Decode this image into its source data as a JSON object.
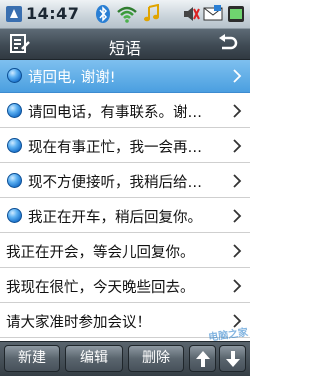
{
  "status_bar": {
    "time": "14:47",
    "icons": [
      "phone-signal-icon",
      "bluetooth-icon",
      "wifi-icon",
      "music-note-icon",
      "sound-icon",
      "mail-icon",
      "battery-icon"
    ]
  },
  "header": {
    "title": "短语",
    "left_icon": "compose-icon",
    "right_icon": "back-arrow-icon"
  },
  "list": {
    "items": [
      {
        "label": "请回电, 谢谢!",
        "has_bullet": true,
        "selected": true
      },
      {
        "label": "请回电话，有事联系。谢…",
        "has_bullet": true,
        "selected": false
      },
      {
        "label": "现在有事正忙，我一会再…",
        "has_bullet": true,
        "selected": false
      },
      {
        "label": "现不方便接听，我稍后给…",
        "has_bullet": true,
        "selected": false
      },
      {
        "label": "我正在开车，稍后回复你。",
        "has_bullet": true,
        "selected": false
      },
      {
        "label": "我正在开会，等会儿回复你。",
        "has_bullet": false,
        "selected": false
      },
      {
        "label": "我现在很忙，今天晚些回去。",
        "has_bullet": false,
        "selected": false
      },
      {
        "label": "请大家准时参加会议！",
        "has_bullet": false,
        "selected": false
      }
    ]
  },
  "toolbar": {
    "new_label": "新建",
    "edit_label": "编辑",
    "delete_label": "删除",
    "up_icon": "arrow-up-icon",
    "down_icon": "arrow-down-icon"
  },
  "watermark": "电脑之家"
}
